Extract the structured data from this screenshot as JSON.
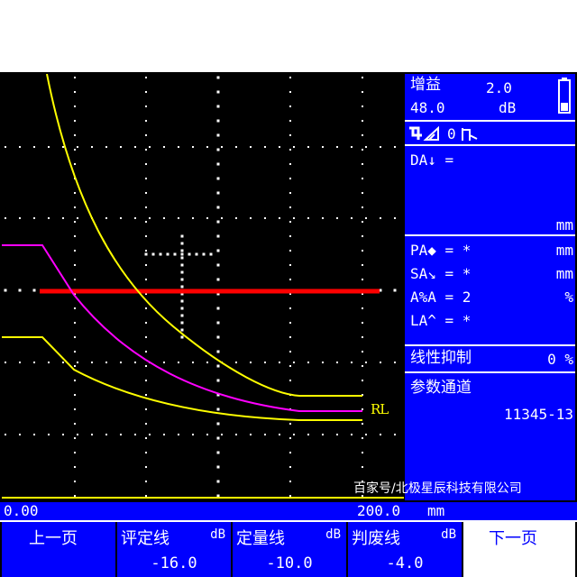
{
  "panel": {
    "gain_label": "增益",
    "gain_step": "2.0",
    "gain_value": "48.0",
    "gain_unit": "dB",
    "mode_text": "0",
    "da_label": "DA↓ =",
    "da_unit": "mm",
    "pa_label": "PA◆ = *",
    "pa_unit": "mm",
    "sa_label": "SA↘ = *",
    "sa_unit": "mm",
    "aa_label": "A%A = 2",
    "aa_unit": "%",
    "la_label": "LA^ = *",
    "reject_label": "线性抑制",
    "reject_value": "0 %",
    "channel_label": "参数通道",
    "channel_value": "11345-13"
  },
  "range": {
    "start": "0.00",
    "end": "200.0",
    "unit": "mm"
  },
  "softkeys": {
    "prev": "上一页",
    "evaluation_label": "评定线",
    "evaluation_unit": "dB",
    "evaluation_value": "-16.0",
    "sizing_label": "定量线",
    "sizing_unit": "dB",
    "sizing_value": "-10.0",
    "reject_line_label": "判废线",
    "reject_line_unit": "dB",
    "reject_line_value": "-4.0",
    "next": "下一页"
  },
  "plot": {
    "rl_label": "RL",
    "gate_color": "#ff0000",
    "curve_color": "#ffff00",
    "mid_curve_color": "#ff00ff"
  },
  "watermark": "百家号/北极星辰科技有限公司"
}
